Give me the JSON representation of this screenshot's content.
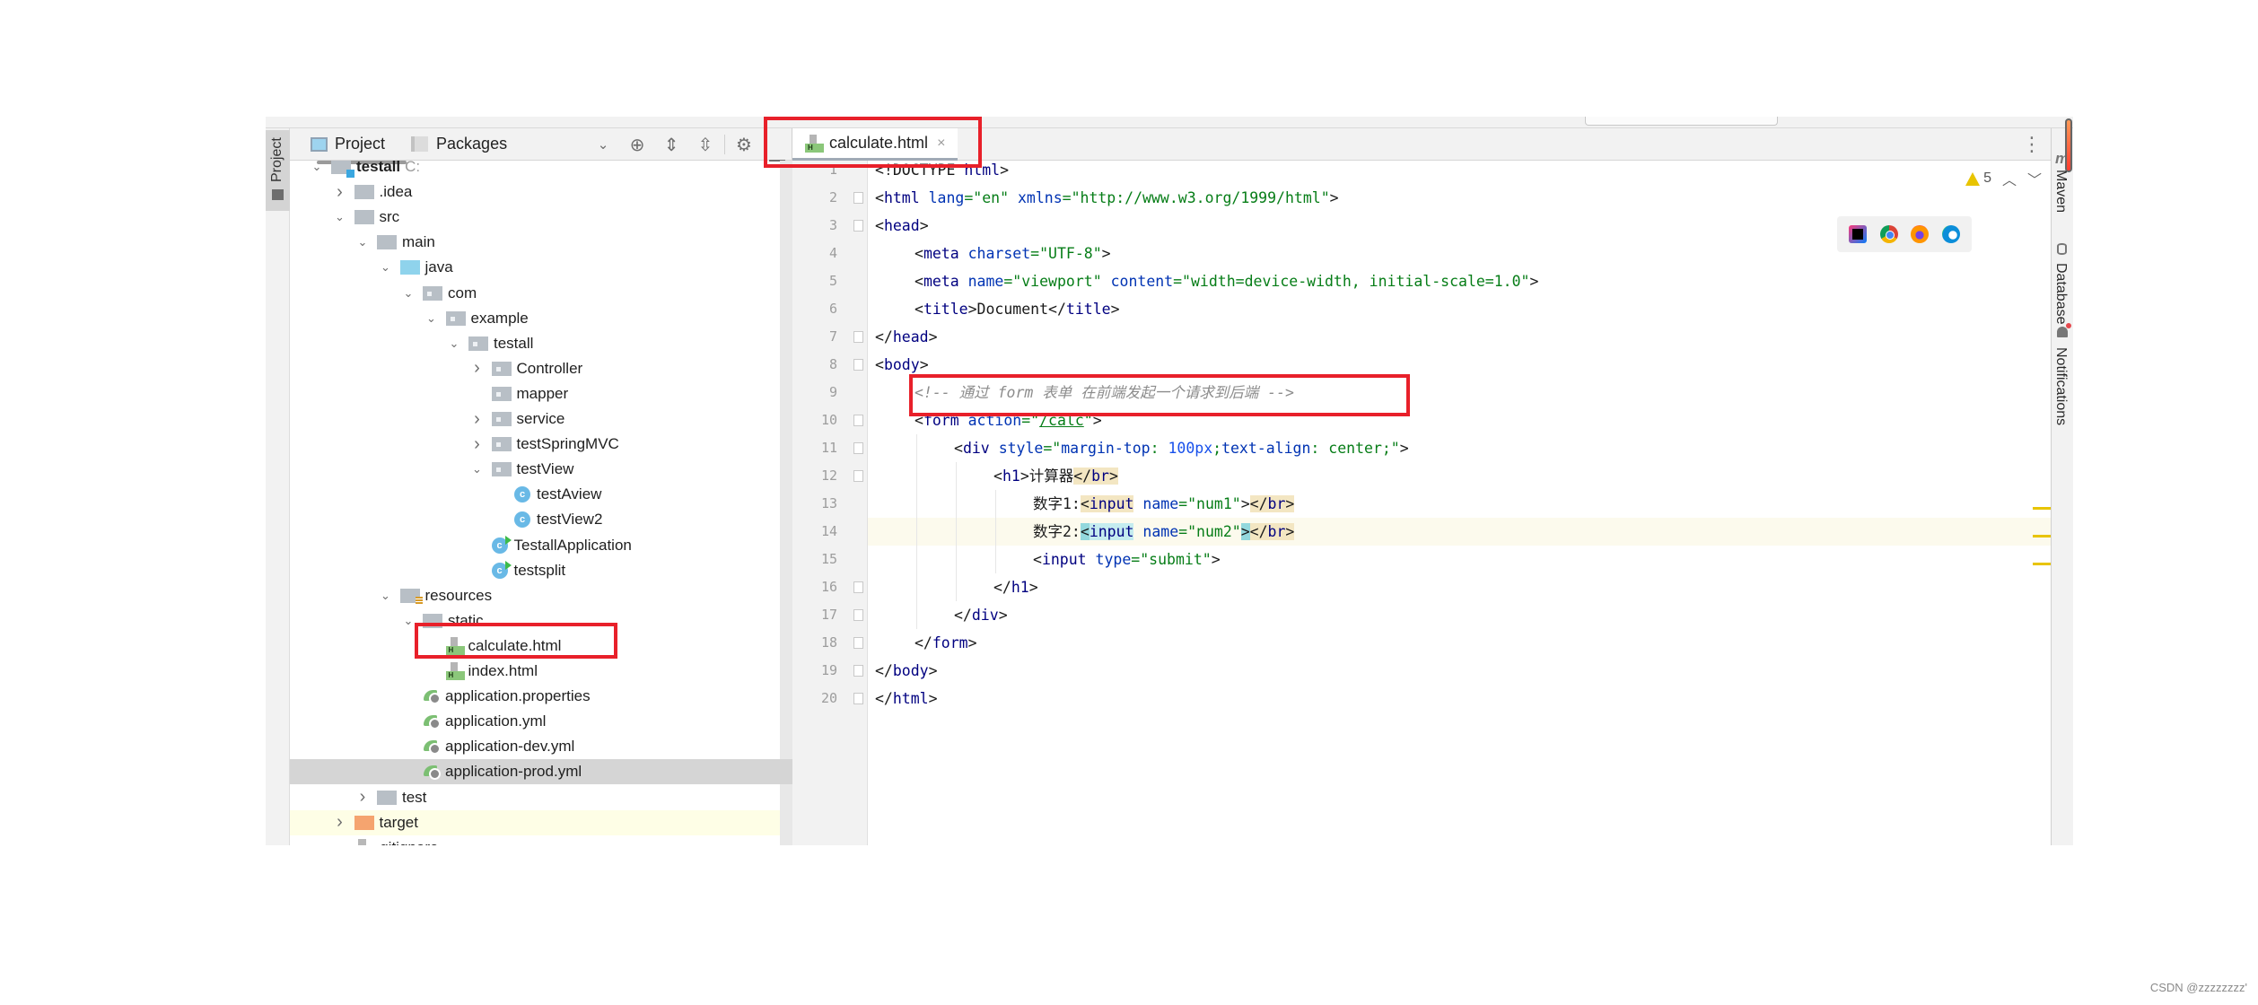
{
  "left_stripe": {
    "project_label": "Project"
  },
  "project_panel": {
    "tabs": [
      "Project",
      "Packages"
    ],
    "tool_icons": [
      "chevron-down-icon",
      "locate-icon",
      "expand-all-icon",
      "collapse-all-icon",
      "gear-icon",
      "minimize-icon"
    ],
    "tree": [
      {
        "label": "testall",
        "suffix": "C:",
        "depth": 0,
        "expanded": true,
        "type": "module"
      },
      {
        "label": ".idea",
        "depth": 1,
        "expanded": false,
        "type": "folder"
      },
      {
        "label": "src",
        "depth": 1,
        "expanded": true,
        "type": "folder"
      },
      {
        "label": "main",
        "depth": 2,
        "expanded": true,
        "type": "folder"
      },
      {
        "label": "java",
        "depth": 3,
        "expanded": true,
        "type": "source-folder"
      },
      {
        "label": "com",
        "depth": 4,
        "expanded": true,
        "type": "package"
      },
      {
        "label": "example",
        "depth": 5,
        "expanded": true,
        "type": "package"
      },
      {
        "label": "testall",
        "depth": 6,
        "expanded": true,
        "type": "package"
      },
      {
        "label": "Controller",
        "depth": 7,
        "expanded": false,
        "type": "package"
      },
      {
        "label": "mapper",
        "depth": 7,
        "type": "package"
      },
      {
        "label": "service",
        "depth": 7,
        "expanded": false,
        "type": "package"
      },
      {
        "label": "testSpringMVC",
        "depth": 7,
        "expanded": false,
        "type": "package"
      },
      {
        "label": "testView",
        "depth": 7,
        "expanded": true,
        "type": "package"
      },
      {
        "label": "testAview",
        "depth": 8,
        "type": "class"
      },
      {
        "label": "testView2",
        "depth": 8,
        "type": "class"
      },
      {
        "label": "TestallApplication",
        "depth": 7,
        "type": "spring-app"
      },
      {
        "label": "testsplit",
        "depth": 7,
        "type": "runnable-class"
      },
      {
        "label": "resources",
        "depth": 3,
        "expanded": true,
        "type": "resources-folder"
      },
      {
        "label": "static",
        "depth": 4,
        "expanded": true,
        "type": "folder"
      },
      {
        "label": "calculate.html",
        "depth": 5,
        "type": "html",
        "annotated": true
      },
      {
        "label": "index.html",
        "depth": 5,
        "type": "html"
      },
      {
        "label": "application.properties",
        "depth": 4,
        "type": "spring-config"
      },
      {
        "label": "application.yml",
        "depth": 4,
        "type": "spring-config"
      },
      {
        "label": "application-dev.yml",
        "depth": 4,
        "type": "spring-config"
      },
      {
        "label": "application-prod.yml",
        "depth": 4,
        "type": "spring-config",
        "selected": true
      },
      {
        "label": "test",
        "depth": 2,
        "expanded": false,
        "type": "folder"
      },
      {
        "label": "target",
        "depth": 1,
        "expanded": false,
        "type": "excluded-folder",
        "highlighted": true
      },
      {
        "label": ".gitignore",
        "depth": 1,
        "type": "gitignore"
      }
    ]
  },
  "editor": {
    "tab": {
      "label": "calculate.html",
      "close": "×"
    },
    "more_icon": "⋮",
    "inspection": {
      "warnings": "5",
      "prev": "^",
      "next": "v"
    },
    "browsers": [
      "intellij-icon",
      "chrome-icon",
      "firefox-icon",
      "edge-icon"
    ],
    "current_line": 14,
    "lines": [
      {
        "n": "1",
        "indent": 0,
        "tokens": [
          {
            "c": "t-br",
            "t": "<!DOCTYPE "
          },
          {
            "c": "t-tag",
            "t": "html"
          },
          {
            "c": "t-br",
            "t": ">"
          }
        ]
      },
      {
        "n": "2",
        "indent": 0,
        "fold": "open",
        "tokens": [
          {
            "c": "t-br",
            "t": "<"
          },
          {
            "c": "t-tag",
            "t": "html "
          },
          {
            "c": "t-attr",
            "t": "lang"
          },
          {
            "c": "t-str",
            "t": "=\"en\" "
          },
          {
            "c": "t-attr",
            "t": "xmlns"
          },
          {
            "c": "t-str",
            "t": "=\"http://www.w3.org/1999/html\""
          },
          {
            "c": "t-br",
            "t": ">"
          }
        ]
      },
      {
        "n": "3",
        "indent": 0,
        "fold": "open",
        "tokens": [
          {
            "c": "t-br",
            "t": "<"
          },
          {
            "c": "t-tag",
            "t": "head"
          },
          {
            "c": "t-br",
            "t": ">"
          }
        ]
      },
      {
        "n": "4",
        "indent": 1,
        "tokens": [
          {
            "c": "t-br",
            "t": "<"
          },
          {
            "c": "t-tag",
            "t": "meta "
          },
          {
            "c": "t-attr",
            "t": "charset"
          },
          {
            "c": "t-str",
            "t": "=\"UTF-8\""
          },
          {
            "c": "t-br",
            "t": ">"
          }
        ]
      },
      {
        "n": "5",
        "indent": 1,
        "tokens": [
          {
            "c": "t-br",
            "t": "<"
          },
          {
            "c": "t-tag",
            "t": "meta "
          },
          {
            "c": "t-attr",
            "t": "name"
          },
          {
            "c": "t-str",
            "t": "=\"viewport\" "
          },
          {
            "c": "t-attr",
            "t": "content"
          },
          {
            "c": "t-str",
            "t": "=\"width=device-width, initial-scale=1.0\""
          },
          {
            "c": "t-br",
            "t": ">"
          }
        ]
      },
      {
        "n": "6",
        "indent": 1,
        "tokens": [
          {
            "c": "t-br",
            "t": "<"
          },
          {
            "c": "t-tag",
            "t": "title"
          },
          {
            "c": "t-br",
            "t": ">"
          },
          {
            "c": "t-txt",
            "t": "Document"
          },
          {
            "c": "t-br",
            "t": "</"
          },
          {
            "c": "t-tag",
            "t": "title"
          },
          {
            "c": "t-br",
            "t": ">"
          }
        ]
      },
      {
        "n": "7",
        "indent": 0,
        "fold": "close",
        "tokens": [
          {
            "c": "t-br",
            "t": "</"
          },
          {
            "c": "t-tag",
            "t": "head"
          },
          {
            "c": "t-br",
            "t": ">"
          }
        ]
      },
      {
        "n": "8",
        "indent": 0,
        "fold": "open",
        "tokens": [
          {
            "c": "t-br",
            "t": "<"
          },
          {
            "c": "t-tag",
            "t": "body"
          },
          {
            "c": "t-br",
            "t": ">"
          }
        ]
      },
      {
        "n": "9",
        "indent": 1,
        "tokens": [
          {
            "c": "t-cmt",
            "t": "<!-- 通过 form 表单 在前端发起一个请求到后端 -->"
          }
        ]
      },
      {
        "n": "10",
        "indent": 1,
        "fold": "open",
        "tokens": [
          {
            "c": "t-br",
            "t": "<"
          },
          {
            "c": "t-tag",
            "t": "form "
          },
          {
            "c": "t-attr",
            "t": "action"
          },
          {
            "c": "t-str",
            "t": "=\""
          },
          {
            "c": "t-str uline",
            "t": "/calc"
          },
          {
            "c": "t-str",
            "t": "\""
          },
          {
            "c": "t-br",
            "t": ">"
          }
        ]
      },
      {
        "n": "11",
        "indent": 2,
        "fold": "open",
        "tokens": [
          {
            "c": "t-br",
            "t": "<"
          },
          {
            "c": "t-tag",
            "t": "div "
          },
          {
            "c": "t-attr",
            "t": "style"
          },
          {
            "c": "t-str",
            "t": "=\""
          },
          {
            "c": "t-attr",
            "t": "margin-top"
          },
          {
            "c": "t-str",
            "t": ": "
          },
          {
            "c": "t-kw",
            "t": "100px"
          },
          {
            "c": "t-str",
            "t": ";"
          },
          {
            "c": "t-attr",
            "t": "text-align"
          },
          {
            "c": "t-str",
            "t": ": center;\""
          },
          {
            "c": "t-br",
            "t": ">"
          }
        ]
      },
      {
        "n": "12",
        "indent": 3,
        "fold": "open",
        "tokens": [
          {
            "c": "t-br",
            "t": "<"
          },
          {
            "c": "t-tag",
            "t": "h1"
          },
          {
            "c": "t-br",
            "t": ">"
          },
          {
            "c": "t-txt",
            "t": "计算器"
          },
          {
            "c": "t-br hl-y",
            "t": "</"
          },
          {
            "c": "t-tag hl-y",
            "t": "br"
          },
          {
            "c": "t-br hl-y",
            "t": ">"
          }
        ]
      },
      {
        "n": "13",
        "indent": 4,
        "tokens": [
          {
            "c": "t-txt",
            "t": "数字1:"
          },
          {
            "c": "t-br hl-y",
            "t": "<"
          },
          {
            "c": "t-tag hl-y",
            "t": "input"
          },
          {
            "c": "t-txt",
            "t": " "
          },
          {
            "c": "t-attr",
            "t": "name"
          },
          {
            "c": "t-str",
            "t": "=\"num1\""
          },
          {
            "c": "t-br",
            "t": ">"
          },
          {
            "c": "t-br hl-y",
            "t": "</"
          },
          {
            "c": "t-tag hl-y",
            "t": "br"
          },
          {
            "c": "t-br hl-y",
            "t": ">"
          }
        ]
      },
      {
        "n": "14",
        "indent": 4,
        "tokens": [
          {
            "c": "t-txt",
            "t": "数字2:"
          },
          {
            "c": "t-br hl-cc",
            "t": "<"
          },
          {
            "c": "t-tag hl-c",
            "t": "input"
          },
          {
            "c": "t-txt",
            "t": " "
          },
          {
            "c": "t-attr",
            "t": "name"
          },
          {
            "c": "t-str",
            "t": "=\"num2\""
          },
          {
            "c": "t-br hl-cc",
            "t": ">"
          },
          {
            "c": "t-br hl-y",
            "t": "</"
          },
          {
            "c": "t-tag hl-y",
            "t": "br"
          },
          {
            "c": "t-br hl-y",
            "t": ">"
          }
        ]
      },
      {
        "n": "15",
        "indent": 4,
        "tokens": [
          {
            "c": "t-br",
            "t": "<"
          },
          {
            "c": "t-tag",
            "t": "input "
          },
          {
            "c": "t-attr",
            "t": "type"
          },
          {
            "c": "t-str",
            "t": "=\"submit\""
          },
          {
            "c": "t-br",
            "t": ">"
          }
        ]
      },
      {
        "n": "16",
        "indent": 3,
        "fold": "close",
        "tokens": [
          {
            "c": "t-br",
            "t": "</"
          },
          {
            "c": "t-tag",
            "t": "h1"
          },
          {
            "c": "t-br",
            "t": ">"
          }
        ]
      },
      {
        "n": "17",
        "indent": 2,
        "fold": "close",
        "tokens": [
          {
            "c": "t-br",
            "t": "</"
          },
          {
            "c": "t-tag",
            "t": "div"
          },
          {
            "c": "t-br",
            "t": ">"
          }
        ]
      },
      {
        "n": "18",
        "indent": 1,
        "fold": "close",
        "tokens": [
          {
            "c": "t-br",
            "t": "</"
          },
          {
            "c": "t-tag",
            "t": "form"
          },
          {
            "c": "t-br",
            "t": ">"
          }
        ]
      },
      {
        "n": "19",
        "indent": 0,
        "fold": "close",
        "tokens": [
          {
            "c": "t-br",
            "t": "</"
          },
          {
            "c": "t-tag",
            "t": "body"
          },
          {
            "c": "t-br",
            "t": ">"
          }
        ]
      },
      {
        "n": "20",
        "indent": 0,
        "fold": "close",
        "tokens": [
          {
            "c": "t-br",
            "t": "</"
          },
          {
            "c": "t-tag",
            "t": "html"
          },
          {
            "c": "t-br",
            "t": ">"
          }
        ]
      }
    ]
  },
  "right_stripe": {
    "items": [
      "Maven",
      "Database",
      "Notifications"
    ]
  },
  "annotations": {
    "color": "#e8202a"
  },
  "watermark": "CSDN @zzzzzzzz'"
}
